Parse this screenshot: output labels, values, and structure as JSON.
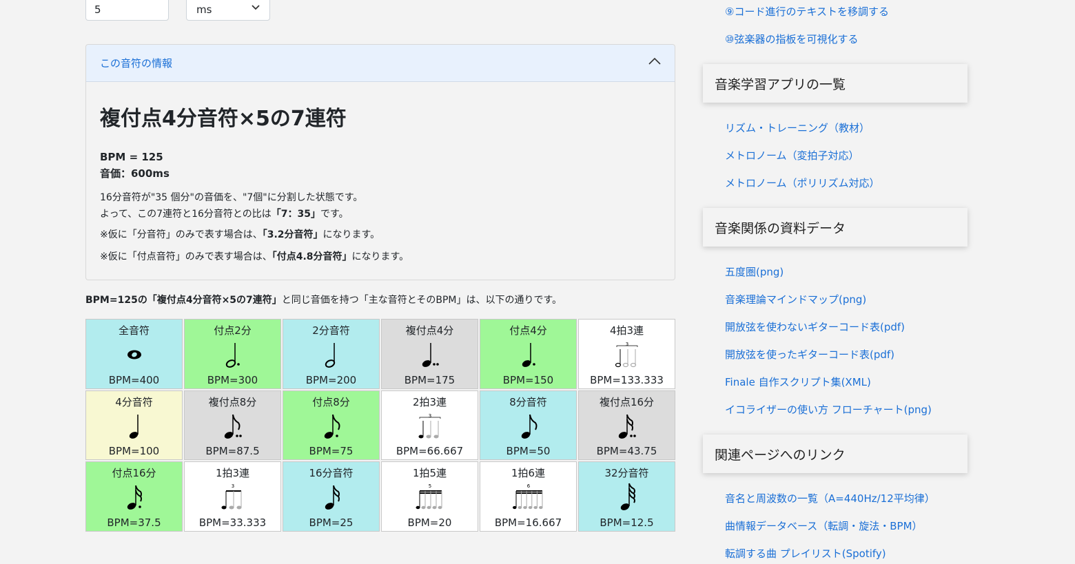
{
  "top": {
    "input_value": "5",
    "unit_select": "ms"
  },
  "card": {
    "header": "この音符の情報",
    "title": "複付点4分音符×5の7連符",
    "bpm_line": "BPM = 125",
    "value_line": "音価：600ms",
    "desc1": "16分音符が\"35 個分\"の音価を、\"7個\"に分割した状態です。",
    "desc2a": "よって、この7連符と16分音符との比は",
    "desc2b": "「7：35」",
    "desc2c": "です。",
    "p3a": "※仮に「分音符」のみで表す場合は、",
    "p3b": "「3.2分音符」",
    "p3c": "になります。",
    "p4a": "※仮に「付点音符」のみで表す場合は、",
    "p4b": "「付点4.8分音符」",
    "p4c": "になります。"
  },
  "intro": {
    "a": "BPM=125の",
    "b": "「複付点4分音符×5の7連符」",
    "c": "と同じ音価を持つ「主な音符とそのBPM」は、以下の通りです。"
  },
  "grid": [
    {
      "name": "全音符",
      "bpm": "BPM=400",
      "color": "#b2ecee",
      "icon": "whole-note-icon"
    },
    {
      "name": "付点2分",
      "bpm": "BPM=300",
      "color": "#9ff797",
      "icon": "dotted-half-note-icon"
    },
    {
      "name": "2分音符",
      "bpm": "BPM=200",
      "color": "#b2ecee",
      "icon": "half-note-icon"
    },
    {
      "name": "複付点4分",
      "bpm": "BPM=175",
      "color": "#dcdcdc",
      "icon": "double-dotted-quarter-note-icon"
    },
    {
      "name": "付点4分",
      "bpm": "BPM=150",
      "color": "#9ff797",
      "icon": "dotted-quarter-note-icon"
    },
    {
      "name": "4拍3連",
      "bpm": "BPM=133.333",
      "color": "#ffffff",
      "icon": "half-triplet-icon"
    },
    {
      "name": "4分音符",
      "bpm": "BPM=100",
      "color": "#f8f8d2",
      "icon": "quarter-note-icon"
    },
    {
      "name": "複付点8分",
      "bpm": "BPM=87.5",
      "color": "#dcdcdc",
      "icon": "double-dotted-eighth-note-icon"
    },
    {
      "name": "付点8分",
      "bpm": "BPM=75",
      "color": "#9ff797",
      "icon": "dotted-eighth-note-icon"
    },
    {
      "name": "2拍3連",
      "bpm": "BPM=66.667",
      "color": "#ffffff",
      "icon": "quarter-triplet-icon"
    },
    {
      "name": "8分音符",
      "bpm": "BPM=50",
      "color": "#b2ecee",
      "icon": "eighth-note-icon"
    },
    {
      "name": "複付点16分",
      "bpm": "BPM=43.75",
      "color": "#dcdcdc",
      "icon": "double-dotted-sixteenth-note-icon"
    },
    {
      "name": "付点16分",
      "bpm": "BPM=37.5",
      "color": "#9ff797",
      "icon": "dotted-sixteenth-note-icon"
    },
    {
      "name": "1拍3連",
      "bpm": "BPM=33.333",
      "color": "#ffffff",
      "icon": "eighth-triplet-icon"
    },
    {
      "name": "16分音符",
      "bpm": "BPM=25",
      "color": "#b2ecee",
      "icon": "sixteenth-note-icon"
    },
    {
      "name": "1拍5連",
      "bpm": "BPM=20",
      "color": "#ffffff",
      "icon": "quintuplet-icon"
    },
    {
      "name": "1拍6連",
      "bpm": "BPM=16.667",
      "color": "#ffffff",
      "icon": "sextuplet-icon"
    },
    {
      "name": "32分音符",
      "bpm": "BPM=12.5",
      "color": "#b2ecee",
      "icon": "thirty-second-note-icon"
    }
  ],
  "tuplet_labels": {
    "t3": "3",
    "t5": "5",
    "t6": "6"
  },
  "sidebar": {
    "top_links": [
      "⑨コード進行のテキストを移調する",
      "⑩弦楽器の指板を可視化する"
    ],
    "sections": [
      {
        "title": "音楽学習アプリの一覧",
        "links": [
          "リズム・トレーニング（教材）",
          "メトロノーム（変拍子対応）",
          "メトロノーム（ポリリズム対応）"
        ]
      },
      {
        "title": "音楽関係の資料データ",
        "links": [
          "五度圏(png)",
          "音楽理論マインドマップ(png)",
          "開放弦を使わないギターコード表(pdf)",
          "開放弦を使ったギターコード表(pdf)",
          "Finale 自作スクリプト集(XML)",
          "イコライザーの使い方 フローチャート(png)"
        ]
      },
      {
        "title": "関連ページへのリンク",
        "links": [
          "音名と周波数の一覧（A=440Hz/12平均律）",
          "曲情報データベース（転調・旋法・BPM）",
          "転調する曲 プレイリスト(Spotify)"
        ]
      }
    ]
  }
}
